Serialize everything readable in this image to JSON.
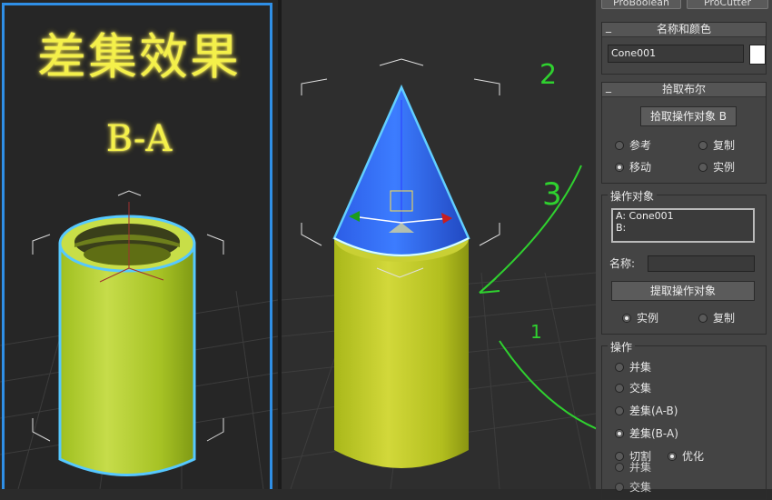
{
  "left_viewport": {
    "title": "差集效果",
    "subtitle": "B-A"
  },
  "annotations": {
    "step2": "2",
    "step3": "3",
    "step1": "1"
  },
  "panel": {
    "top_buttons": [
      "ProBoolean",
      "ProCutter"
    ],
    "name_color": {
      "header": "名称和颜色",
      "name_value": "Cone001",
      "color": "#ffffff"
    },
    "pick_boolean": {
      "header": "拾取布尔",
      "pick_button": "拾取操作对象 B",
      "options": [
        {
          "label": "参考",
          "selected": false
        },
        {
          "label": "复制",
          "selected": false
        },
        {
          "label": "移动",
          "selected": true
        },
        {
          "label": "实例",
          "selected": false
        }
      ]
    },
    "operands": {
      "label": "操作对象",
      "list": [
        "A: Cone001",
        "B:"
      ],
      "name_label": "名称:",
      "name_value": "",
      "extract_button": "提取操作对象",
      "options": [
        {
          "label": "实例",
          "selected": true
        },
        {
          "label": "复制",
          "selected": false
        }
      ]
    },
    "operation": {
      "label": "操作",
      "options": [
        {
          "label": "并集",
          "selected": false
        },
        {
          "label": "交集",
          "selected": false
        },
        {
          "label": "差集(A-B)",
          "selected": false
        },
        {
          "label": "差集(B-A)",
          "selected": true
        },
        {
          "label": "切割",
          "selected": false
        }
      ],
      "extra_option": "优化",
      "overlay_options": [
        "并集",
        "交集"
      ]
    }
  },
  "colors": {
    "frame": "#2f8fe6",
    "cylinder": "#b8cf2a",
    "cone": "#2f6ef0",
    "annotation": "#2fd12f",
    "title": "#f4f04a"
  }
}
